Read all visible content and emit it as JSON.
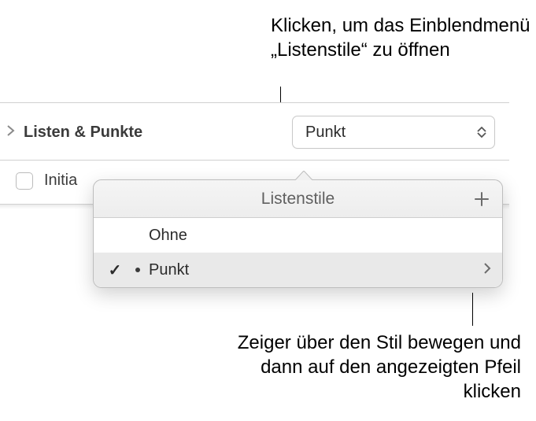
{
  "callouts": {
    "top": "Klicken, um das Einblendmenü „Listenstile“ zu öffnen",
    "bottom": "Zeiger über den Stil bewegen und dann auf den angezeigten Pfeil klicken"
  },
  "inspector": {
    "section_label": "Listen & Punkte",
    "popup_value": "Punkt",
    "initial_label": "Initia"
  },
  "popover": {
    "title": "Listenstile",
    "items": [
      {
        "label": "Ohne",
        "selected": false,
        "has_bullet": false,
        "has_arrow": false
      },
      {
        "label": "Punkt",
        "selected": true,
        "has_bullet": true,
        "has_arrow": true
      }
    ]
  }
}
